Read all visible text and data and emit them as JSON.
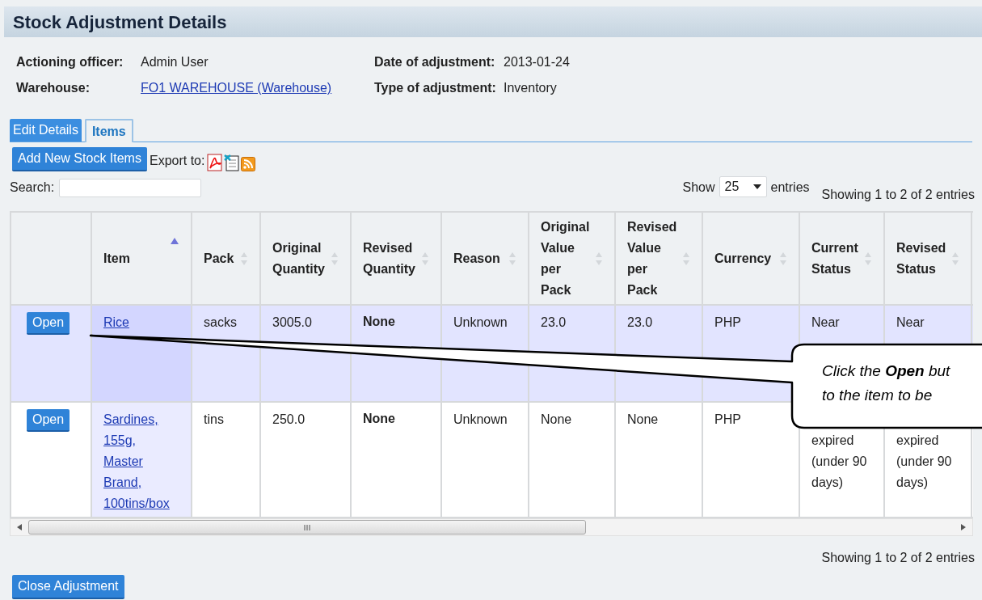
{
  "title": "Stock Adjustment Details",
  "details": [
    {
      "label": "Actioning officer:",
      "value": "Admin User",
      "kind": "text"
    },
    {
      "label": "Date of adjustment:",
      "value": "2013-01-24",
      "kind": "text"
    },
    {
      "label": "Warehouse:",
      "value": "FO1 WAREHOUSE (Warehouse)",
      "kind": "link"
    },
    {
      "label": "Type of adjustment:",
      "value": "Inventory",
      "kind": "text"
    }
  ],
  "tabs": [
    {
      "label": "Edit Details",
      "selected": false
    },
    {
      "label": "Items",
      "selected": true
    }
  ],
  "add_button": "Add New Stock Items",
  "export_label": "Export to:",
  "search": {
    "label": "Search:"
  },
  "page_size": {
    "before": "Show",
    "value": "25",
    "after": "entries"
  },
  "info_top": "Showing 1 to 2 of 2 entries",
  "table": {
    "columns": [
      {},
      {
        "label": "Item",
        "sorted": true
      },
      {
        "label": "Pack",
        "sorted": false
      },
      {
        "label": "Original Quantity",
        "sorted": false
      },
      {
        "label": "Revised Quantity",
        "sorted": false
      },
      {
        "label": "Reason",
        "sorted": false
      },
      {
        "label": "Original Value per Pack",
        "sorted": false
      },
      {
        "label": "Revised Value per Pack",
        "sorted": false
      },
      {
        "label": "Currency",
        "sorted": false
      },
      {
        "label": "Current Status",
        "sorted": false
      },
      {
        "label": "Revised Status",
        "sorted": false
      }
    ],
    "rows": [
      {
        "selected": true,
        "cells": [
          {
            "kind": "button",
            "text": "Open"
          },
          {
            "kind": "link",
            "text": "Rice"
          },
          {
            "kind": "text",
            "text": "sacks"
          },
          {
            "kind": "text",
            "text": "3005.0"
          },
          {
            "kind": "bold",
            "text": "None"
          },
          {
            "kind": "text",
            "text": "Unknown"
          },
          {
            "kind": "text",
            "text": "23.0"
          },
          {
            "kind": "text",
            "text": "23.0"
          },
          {
            "kind": "text",
            "text": "PHP"
          },
          {
            "kind": "text",
            "text": "Near"
          },
          {
            "kind": "text",
            "text": "Near"
          }
        ]
      },
      {
        "selected": false,
        "cells": [
          {
            "kind": "button",
            "text": "Open"
          },
          {
            "kind": "link",
            "text": "Sardines, 155g, Master Brand, 100tins/box"
          },
          {
            "kind": "text",
            "text": "tins"
          },
          {
            "kind": "text",
            "text": "250.0"
          },
          {
            "kind": "bold",
            "text": "None"
          },
          {
            "kind": "text",
            "text": "Unknown"
          },
          {
            "kind": "text",
            "text": "None"
          },
          {
            "kind": "text",
            "text": "None"
          },
          {
            "kind": "text",
            "text": "PHP"
          },
          {
            "kind": "covered",
            "text": "expired (under 90 days)"
          },
          {
            "kind": "covered",
            "text": "expired (under 90 days)"
          }
        ]
      }
    ]
  },
  "info_bottom": "Showing 1 to 2 of 2 entries",
  "close_button": "Close Adjustment",
  "callout": {
    "lines": [
      "*Click the* **Open** *but*",
      "*to the item to be*"
    ]
  }
}
